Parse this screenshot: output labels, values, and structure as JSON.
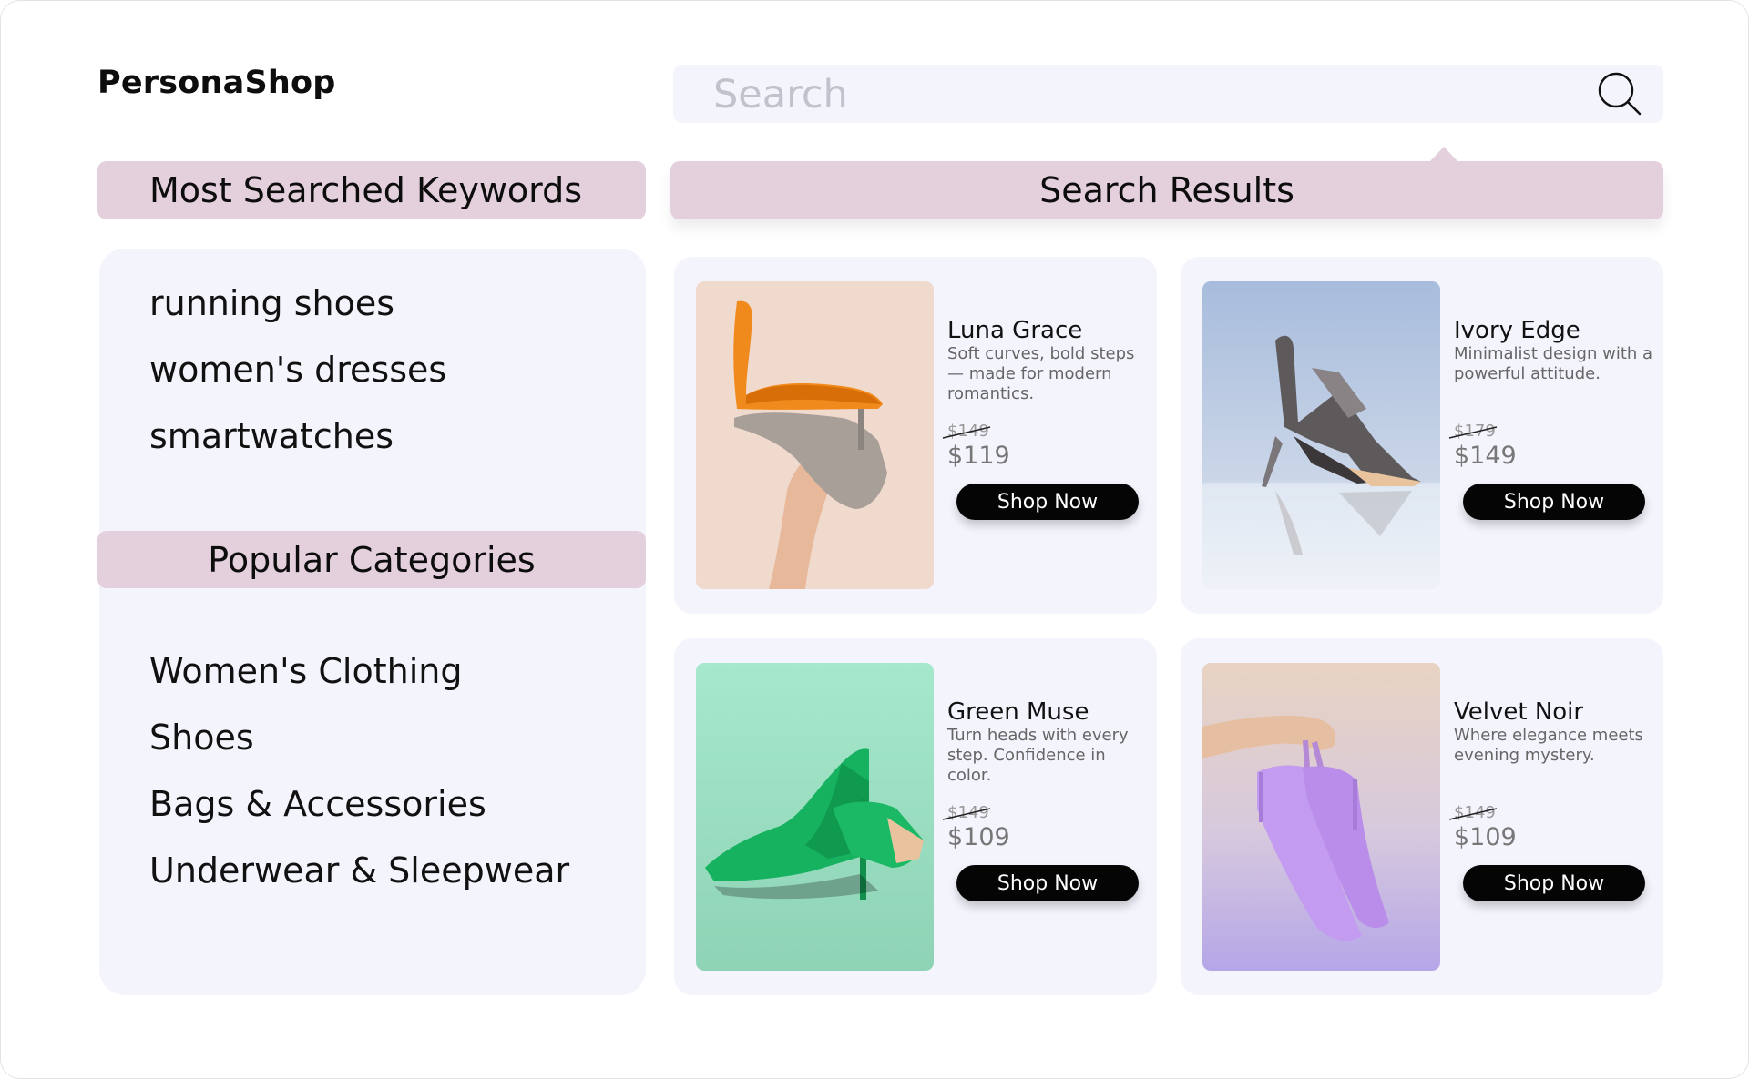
{
  "brand": "PersonaShop",
  "search": {
    "placeholder": "Search"
  },
  "keywords": {
    "title": "Most Searched Keywords",
    "items": [
      "running shoes",
      "women's dresses",
      "smartwatches"
    ]
  },
  "categories": {
    "title": "Popular Categories",
    "items": [
      "Women's Clothing",
      "Shoes",
      "Bags & Accessories",
      "Underwear & Sleepwear"
    ]
  },
  "results": {
    "title": "Search Results",
    "products": [
      {
        "name": "Luna Grace",
        "description": "Soft curves, bold steps — made for modern romantics.",
        "old_price": "$149",
        "price": "$119",
        "button": "Shop Now",
        "image": "orange-heel-photo"
      },
      {
        "name": "Ivory Edge",
        "description": "Minimalist design with a powerful attitude.",
        "old_price": "$179",
        "price": "$149",
        "button": "Shop Now",
        "image": "strappy-sandal-photo"
      },
      {
        "name": "Green Muse",
        "description": "Turn heads with every step. Confidence in color.",
        "old_price": "$149",
        "price": "$109",
        "button": "Shop Now",
        "image": "green-pumps-photo"
      },
      {
        "name": "Velvet Noir",
        "description": "Where elegance meets evening mystery.",
        "old_price": "$149",
        "price": "$109",
        "button": "Shop Now",
        "image": "lilac-slingback-photo"
      }
    ]
  },
  "colors": {
    "panel_bg": "#f4f4fd",
    "header_pill": "#e4d0dd",
    "button_bg": "#050505",
    "button_text": "#ffffff"
  }
}
